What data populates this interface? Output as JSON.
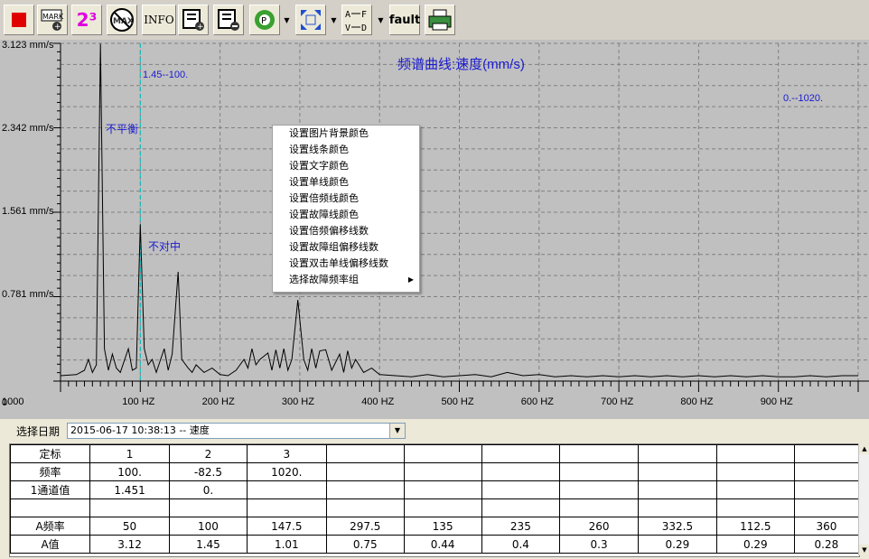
{
  "toolbar": {
    "buttons": [
      {
        "name": "stop-icon",
        "label": ""
      },
      {
        "name": "mark-add-icon",
        "label": "MARK"
      },
      {
        "name": "number-23-icon",
        "label": "2³"
      },
      {
        "name": "max-off-icon",
        "label": "MAX"
      },
      {
        "name": "info-icon",
        "label": "INFO"
      },
      {
        "name": "list-add-icon",
        "label": ""
      },
      {
        "name": "list-remove-icon",
        "label": ""
      },
      {
        "name": "refresh-p-icon",
        "label": "P"
      },
      {
        "name": "fit-screen-icon",
        "label": ""
      },
      {
        "name": "axis-swap-icon",
        "label": "A F V D"
      },
      {
        "name": "fault-icon",
        "label": "fault"
      },
      {
        "name": "printer-icon",
        "label": ""
      }
    ]
  },
  "chart": {
    "title": "频谱曲线:速度(mm/s)",
    "y_labels": [
      "3.123 mm/s",
      "2.342 mm/s",
      "1.561 mm/s",
      "0.781 mm/s",
      "0"
    ],
    "cursor_label": "1.45--100.",
    "cursor_label_right": "0.--1020.",
    "annotations": [
      "不平衡",
      "不对中"
    ]
  },
  "chart_data": {
    "type": "line",
    "title": "频谱曲线:速度(mm/s)",
    "xlabel": "",
    "ylabel": "",
    "xlim": [
      0,
      1000
    ],
    "ylim": [
      0,
      3.123
    ],
    "x_ticks": [
      "100 HZ",
      "200 HZ",
      "300 HZ",
      "400 HZ",
      "500 HZ",
      "600 HZ",
      "700 HZ",
      "800 HZ",
      "900 HZ",
      "1000"
    ],
    "y_ticks": [
      0,
      0.781,
      1.561,
      2.342,
      3.123
    ],
    "grid": true,
    "series": [
      {
        "values": [
          [
            0,
            0.05
          ],
          [
            20,
            0.06
          ],
          [
            30,
            0.1
          ],
          [
            35,
            0.2
          ],
          [
            40,
            0.08
          ],
          [
            45,
            0.15
          ],
          [
            50,
            3.12
          ],
          [
            55,
            0.3
          ],
          [
            60,
            0.1
          ],
          [
            65,
            0.25
          ],
          [
            70,
            0.12
          ],
          [
            75,
            0.08
          ],
          [
            85,
            0.3
          ],
          [
            90,
            0.1
          ],
          [
            95,
            0.12
          ],
          [
            100,
            1.45
          ],
          [
            105,
            0.3
          ],
          [
            110,
            0.15
          ],
          [
            115,
            0.2
          ],
          [
            120,
            0.08
          ],
          [
            130,
            0.3
          ],
          [
            135,
            0.1
          ],
          [
            140,
            0.25
          ],
          [
            147.5,
            1.01
          ],
          [
            152,
            0.2
          ],
          [
            160,
            0.12
          ],
          [
            165,
            0.08
          ],
          [
            170,
            0.15
          ],
          [
            180,
            0.08
          ],
          [
            190,
            0.12
          ],
          [
            200,
            0.06
          ],
          [
            210,
            0.05
          ],
          [
            220,
            0.1
          ],
          [
            230,
            0.2
          ],
          [
            235,
            0.12
          ],
          [
            240,
            0.3
          ],
          [
            245,
            0.15
          ],
          [
            250,
            0.2
          ],
          [
            260,
            0.26
          ],
          [
            265,
            0.1
          ],
          [
            270,
            0.29
          ],
          [
            275,
            0.12
          ],
          [
            280,
            0.3
          ],
          [
            285,
            0.1
          ],
          [
            290,
            0.2
          ],
          [
            297.5,
            0.75
          ],
          [
            305,
            0.2
          ],
          [
            310,
            0.1
          ],
          [
            315,
            0.3
          ],
          [
            320,
            0.12
          ],
          [
            325,
            0.28
          ],
          [
            332.5,
            0.29
          ],
          [
            340,
            0.1
          ],
          [
            350,
            0.25
          ],
          [
            355,
            0.08
          ],
          [
            360,
            0.28
          ],
          [
            365,
            0.12
          ],
          [
            370,
            0.2
          ],
          [
            380,
            0.08
          ],
          [
            390,
            0.12
          ],
          [
            400,
            0.06
          ],
          [
            420,
            0.05
          ],
          [
            440,
            0.04
          ],
          [
            460,
            0.06
          ],
          [
            480,
            0.04
          ],
          [
            500,
            0.05
          ],
          [
            520,
            0.06
          ],
          [
            540,
            0.04
          ],
          [
            560,
            0.08
          ],
          [
            580,
            0.05
          ],
          [
            600,
            0.06
          ],
          [
            620,
            0.04
          ],
          [
            640,
            0.05
          ],
          [
            660,
            0.04
          ],
          [
            680,
            0.05
          ],
          [
            700,
            0.04
          ],
          [
            720,
            0.05
          ],
          [
            740,
            0.04
          ],
          [
            760,
            0.05
          ],
          [
            780,
            0.04
          ],
          [
            800,
            0.05
          ],
          [
            820,
            0.04
          ],
          [
            840,
            0.05
          ],
          [
            860,
            0.04
          ],
          [
            880,
            0.05
          ],
          [
            900,
            0.04
          ],
          [
            920,
            0.04
          ],
          [
            940,
            0.05
          ],
          [
            960,
            0.04
          ],
          [
            980,
            0.05
          ],
          [
            1000,
            0.05
          ]
        ]
      }
    ]
  },
  "context_menu": {
    "items": [
      "设置图片背景颜色",
      "设置线条颜色",
      "设置文字颜色",
      "设置单线颜色",
      "设置倍频线颜色",
      "设置故障线颜色",
      "设置倍频偏移线数",
      "设置故障组偏移线数",
      "设置双击单线偏移线数",
      "选择故障频率组"
    ]
  },
  "date_bar": {
    "label": "选择日期",
    "selected": "2015-06-17 10:38:13 -- 速度"
  },
  "table": {
    "rows": [
      [
        "定标",
        "1",
        "2",
        "3",
        "",
        "",
        "",
        "",
        "",
        "",
        ""
      ],
      [
        "频率",
        "100.",
        "-82.5",
        "1020.",
        "",
        "",
        "",
        "",
        "",
        "",
        ""
      ],
      [
        "1通道值",
        "1.451",
        "0.",
        "",
        "",
        "",
        "",
        "",
        "",
        "",
        ""
      ],
      [
        "",
        "",
        "",
        "",
        "",
        "",
        "",
        "",
        "",
        "",
        ""
      ],
      [
        "A频率",
        "50",
        "100",
        "147.5",
        "297.5",
        "135",
        "235",
        "260",
        "332.5",
        "112.5",
        "360"
      ],
      [
        "A值",
        "3.12",
        "1.45",
        "1.01",
        "0.75",
        "0.44",
        "0.4",
        "0.3",
        "0.29",
        "0.29",
        "0.28"
      ]
    ]
  }
}
